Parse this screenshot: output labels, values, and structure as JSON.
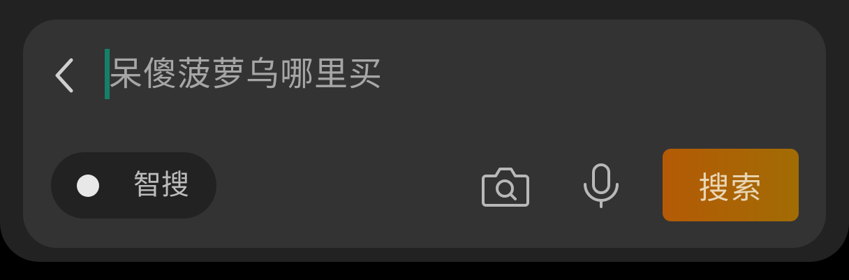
{
  "search_bar": {
    "back_icon": "chevron-left-icon",
    "placeholder": "呆傻菠萝乌哪里买",
    "caret_color": "#15806a"
  },
  "toolbar": {
    "smart_search_toggle": {
      "label": "智搜",
      "state": "off"
    },
    "camera_icon": "camera-search-icon",
    "mic_icon": "microphone-icon",
    "search_button": {
      "label": "搜索",
      "color_start": "#b45a06",
      "color_end": "#a16c04"
    }
  }
}
